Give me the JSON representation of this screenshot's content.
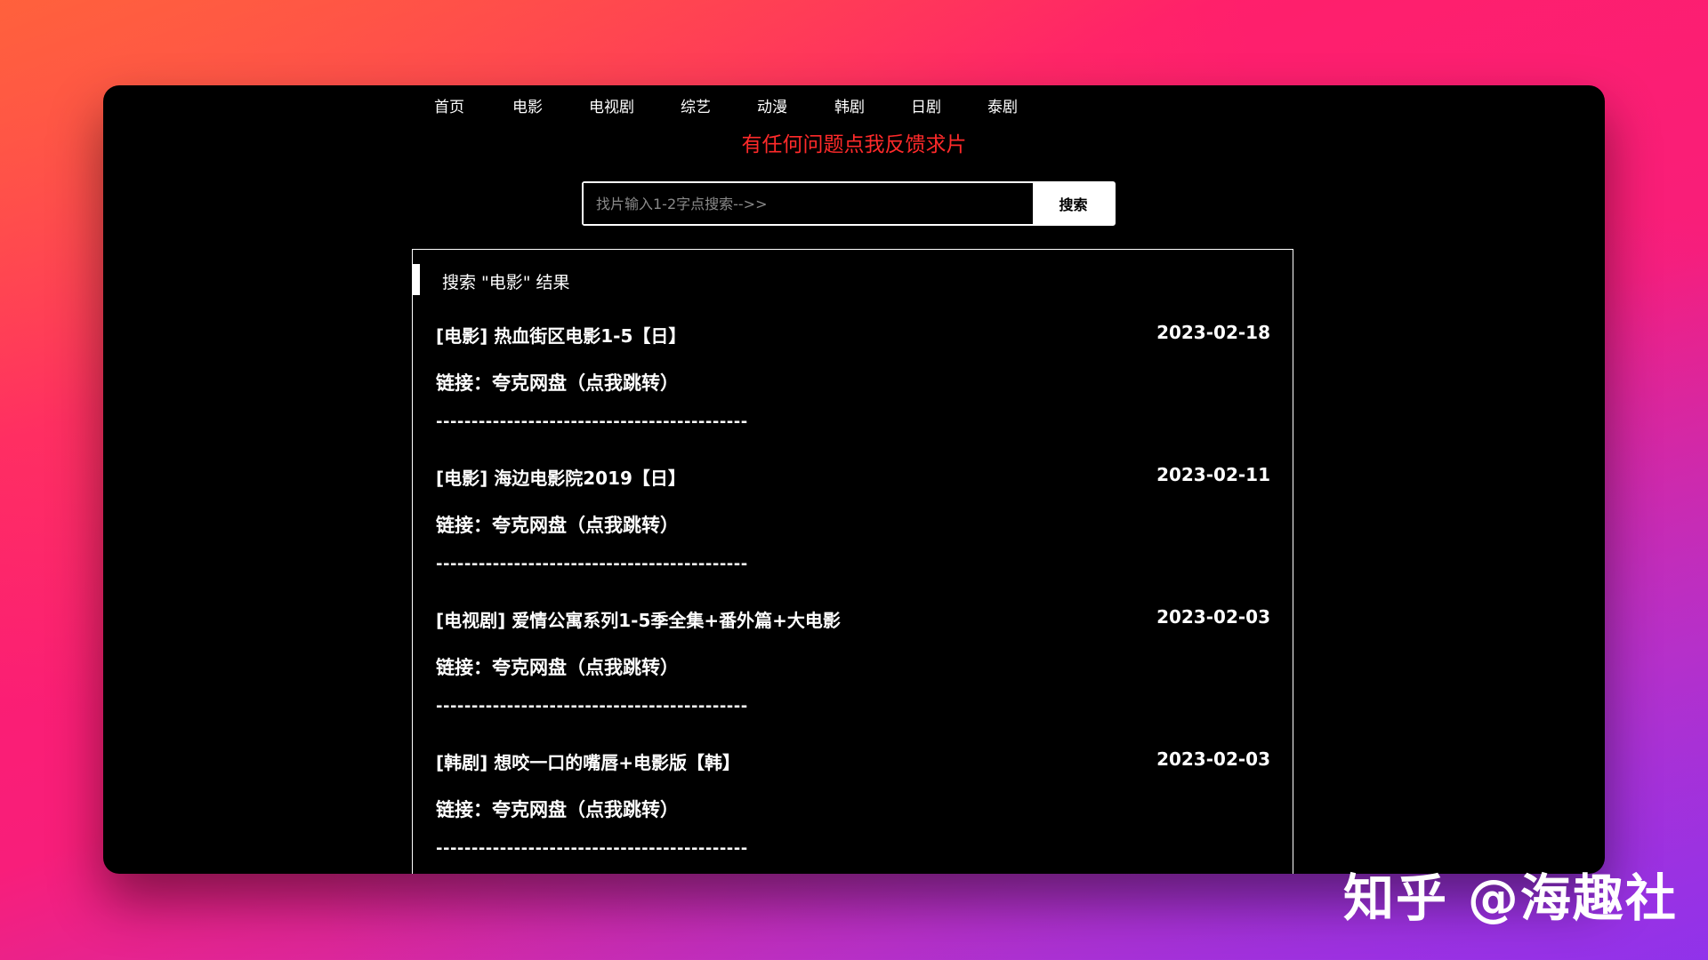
{
  "nav": {
    "items": [
      "首页",
      "电影",
      "电视剧",
      "综艺",
      "动漫",
      "韩剧",
      "日剧",
      "泰剧"
    ]
  },
  "feedback": "有任何问题点我反馈求片",
  "search": {
    "placeholder": "找片输入1-2字点搜索-->>",
    "button_label": "搜索"
  },
  "results": {
    "header": "搜索 \"电影\" 结果",
    "items": [
      {
        "title": "[电影] 热血街区电影1-5【日】",
        "date": "2023-02-18",
        "link": "链接：夸克网盘（点我跳转）",
        "divider": "--------------------------------------------"
      },
      {
        "title": "[电影] 海边电影院2019【日】",
        "date": "2023-02-11",
        "link": "链接：夸克网盘（点我跳转）",
        "divider": "--------------------------------------------"
      },
      {
        "title": "[电视剧] 爱情公寓系列1-5季全集+番外篇+大电影",
        "date": "2023-02-03",
        "link": "链接：夸克网盘（点我跳转）",
        "divider": "--------------------------------------------"
      },
      {
        "title": "[韩剧] 想咬一口的嘴唇+电影版【韩】",
        "date": "2023-02-03",
        "link": "链接：夸克网盘（点我跳转）",
        "divider": "--------------------------------------------"
      }
    ]
  },
  "watermark": "知乎 @海趣社",
  "colors": {
    "feedback": "#ff2a2a",
    "window_bg": "#000000",
    "text": "#ffffff"
  }
}
